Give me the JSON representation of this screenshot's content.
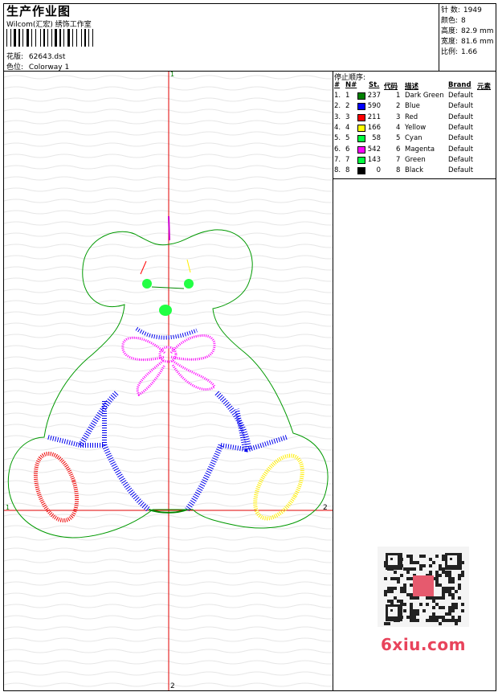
{
  "header": {
    "title": "生产作业图",
    "company": "Wilcom(汇宏) 绣饰工作室",
    "design_label": "花版:",
    "design_file": "62643.dst",
    "color_label": "色位:",
    "colorway": "Colorway 1"
  },
  "stats": [
    {
      "label": "针 数:",
      "value": "1949"
    },
    {
      "label": "颜色:",
      "value": "8"
    },
    {
      "label": "高度:",
      "value": "82.9 mm"
    },
    {
      "label": "宽度:",
      "value": "81.6 mm"
    },
    {
      "label": "比例:",
      "value": "1.66"
    }
  ],
  "legend": {
    "title": "停止顺序:",
    "headers": {
      "num": "#",
      "no": "N#",
      "stitches": "St.",
      "code": "代码",
      "desc": "描述",
      "brand": "Brand",
      "element": "元素"
    },
    "rows": [
      {
        "num": "1.",
        "no": "1",
        "color": "#008000",
        "stitches": "237",
        "code": "1",
        "desc": "Dark Green",
        "brand": "Default"
      },
      {
        "num": "2.",
        "no": "2",
        "color": "#0000ff",
        "stitches": "590",
        "code": "2",
        "desc": "Blue",
        "brand": "Default"
      },
      {
        "num": "3.",
        "no": "3",
        "color": "#ff0000",
        "stitches": "211",
        "code": "3",
        "desc": "Red",
        "brand": "Default"
      },
      {
        "num": "4.",
        "no": "4",
        "color": "#ffff00",
        "stitches": "166",
        "code": "4",
        "desc": "Yellow",
        "brand": "Default"
      },
      {
        "num": "5.",
        "no": "5",
        "color": "#00ff40",
        "stitches": "58",
        "code": "5",
        "desc": "Cyan",
        "brand": "Default"
      },
      {
        "num": "6.",
        "no": "6",
        "color": "#ff00ff",
        "stitches": "542",
        "code": "6",
        "desc": "Magenta",
        "brand": "Default"
      },
      {
        "num": "7.",
        "no": "7",
        "color": "#00ff40",
        "stitches": "143",
        "code": "7",
        "desc": "Green",
        "brand": "Default"
      },
      {
        "num": "8.",
        "no": "8",
        "color": "#000000",
        "stitches": "0",
        "code": "8",
        "desc": "Black",
        "brand": "Default"
      }
    ]
  },
  "axis_markers": {
    "top": "1",
    "bottom": "2",
    "left": "1",
    "right": "2"
  },
  "watermark": {
    "logo_text": "6xiu.com"
  }
}
